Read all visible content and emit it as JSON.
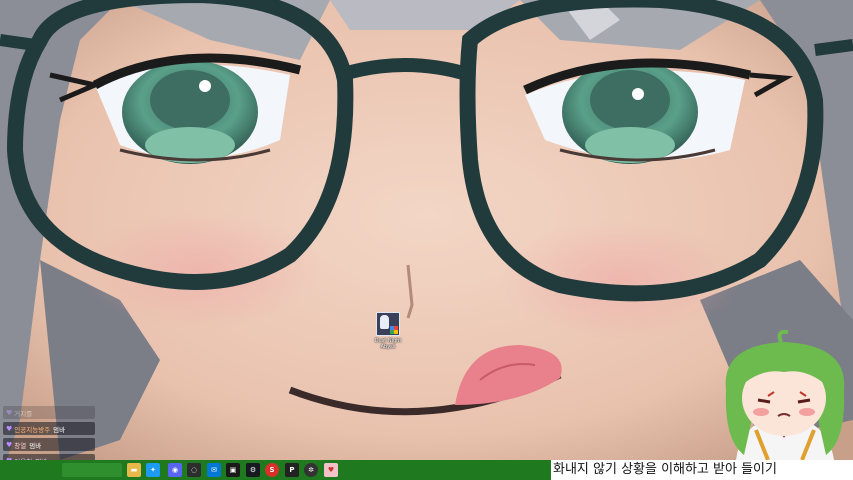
{
  "desktop": {
    "icons": [
      {
        "name": "game-shortcut",
        "label": "Dust Night Abyss"
      }
    ]
  },
  "chat": {
    "messages": [
      {
        "nick": "",
        "text": "거지를",
        "faded": true
      },
      {
        "nick": "인공지능방주",
        "text": "멈바"
      },
      {
        "nick": "창열",
        "text": "멈바"
      },
      {
        "nick": "이용현",
        "text": "멈바"
      }
    ]
  },
  "taskbar": {
    "icons": [
      "folder-icon",
      "twitter-icon",
      "discord-icon",
      "chat-bubble-icon",
      "mail-icon",
      "monitor-icon",
      "steam-icon",
      "s-app-icon",
      "p-app-icon",
      "settings-icon",
      "image-icon"
    ]
  },
  "subtitle": {
    "text": "화내지 않기 상황을 이해하고 받아 들이기"
  },
  "colors": {
    "taskbar": "#1f7a1f",
    "glasses": "#213b3d",
    "eyes": "#5aa089",
    "hair": "#9a9ba3",
    "skin": "#e9c6b4",
    "tongue": "#e8818c"
  }
}
